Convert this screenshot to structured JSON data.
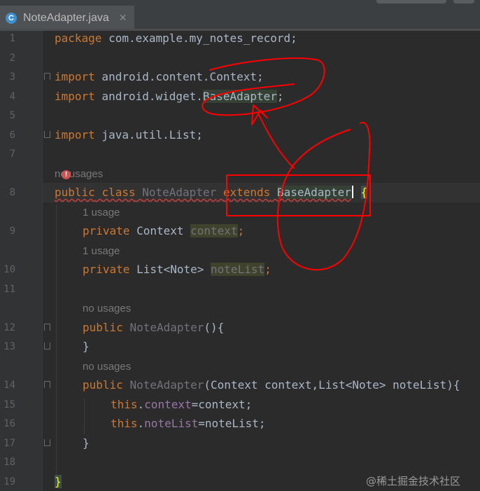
{
  "tab": {
    "title": "NoteAdapter.java",
    "icon_letter": "C",
    "close": "✕"
  },
  "line_numbers": [
    "1",
    "2",
    "3",
    "4",
    "5",
    "6",
    "7",
    "8",
    "9",
    "10",
    "11",
    "12",
    "13",
    "14",
    "15",
    "16",
    "17",
    "18",
    "19"
  ],
  "code": {
    "l1_kw": "package",
    "l1_rest": " com.example.my_notes_record;",
    "l3_kw": "import",
    "l3_rest": " android.content.Context;",
    "l4_kw": "import",
    "l4_rest": " android.widget.",
    "l4_cls": "BaseAdapter",
    "l4_end": ";",
    "l6_kw": "import",
    "l6_rest": " java.util.List;",
    "hint_l8": "no usages",
    "l8_kw1": "public",
    "l8_kw2": "class",
    "l8_name": "NoteAdapter",
    "l8_ext": "extends",
    "l8_base": "BaseAdapter",
    "l8_brace": "{",
    "hint_l9": "1 usage",
    "l9_kw": "private",
    "l9_type": " Context ",
    "l9_fld": "context",
    "l9_end": ";",
    "hint_l10": "1 usage",
    "l10_kw": "private",
    "l10_type": " List<Note> ",
    "l10_fld": "noteList",
    "l10_end": ";",
    "hint_l12": "no usages",
    "l12_kw": "public",
    "l12_name": "NoteAdapter",
    "l12_end": "(){",
    "l13": "}",
    "hint_l14": "no usages",
    "l14_kw": "public",
    "l14_name": "NoteAdapter",
    "l14_rest": "(Context context,List<Note> noteList){",
    "l15_kw": "this",
    "l15_dot": ".",
    "l15_fld": "context",
    "l15_rest": "=context;",
    "l16_kw": "this",
    "l16_dot": ".",
    "l16_fld": "noteList",
    "l16_rest": "=noteList;",
    "l17": "}",
    "l19": "}"
  },
  "error_marker": "!",
  "watermark": "@稀土掘金技术社区",
  "annotation_color": "#ff0000",
  "colors": {
    "keyword": "#cc7832",
    "field": "#9876aa",
    "text": "#a9b7c6",
    "background": "#2b2b2b"
  }
}
